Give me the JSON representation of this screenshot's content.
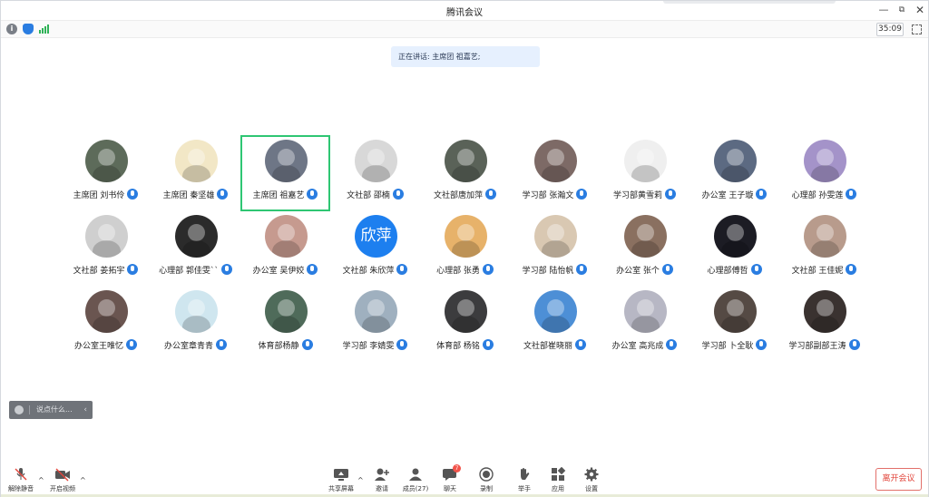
{
  "window": {
    "title": "腾讯会议"
  },
  "infobar": {
    "timer": "35:09"
  },
  "speaking": {
    "text": "正在讲话: 主席团 祖嘉艺;"
  },
  "participants": [
    {
      "name": "主席团 刘书伶",
      "avatar_color": "#5d6b5a",
      "active": false
    },
    {
      "name": "主席团 秦坚雄",
      "avatar_color": "#f2e7c6",
      "active": false
    },
    {
      "name": "主席团 祖嘉艺",
      "avatar_color": "#6e7686",
      "active": true
    },
    {
      "name": "文社部 邵楠",
      "avatar_color": "#d8d8d8",
      "active": false
    },
    {
      "name": "文社部唐加萍",
      "avatar_color": "#5a6258",
      "active": false
    },
    {
      "name": "学习部 张瀚文",
      "avatar_color": "#7d6a66",
      "active": false
    },
    {
      "name": "学习部黄雪莉",
      "avatar_color": "#efefef",
      "active": false
    },
    {
      "name": "办公室 王子璇",
      "avatar_color": "#5c6a82",
      "active": false
    },
    {
      "name": "心理部 孙雯莲",
      "avatar_color": "#a493c9",
      "active": false
    },
    {
      "name": "文社部 姜拓宇",
      "avatar_color": "#cfcfcf",
      "active": false
    },
    {
      "name": "心理部 郭佳雯``",
      "avatar_color": "#2b2b2b",
      "active": false
    },
    {
      "name": "办公室 吴伊姣",
      "avatar_color": "#c69a8f",
      "active": false
    },
    {
      "name": "文社部 朱欣萍",
      "avatar_color": "#1d7fef",
      "avatar_text": "欣萍",
      "active": false
    },
    {
      "name": "心理部 张勇",
      "avatar_color": "#e7b26a",
      "active": false
    },
    {
      "name": "学习部 陆怡帆",
      "avatar_color": "#d9c8b2",
      "active": false
    },
    {
      "name": "办公室 张个",
      "avatar_color": "#8a7060",
      "active": false
    },
    {
      "name": "心理部傅哲",
      "avatar_color": "#1c1c24",
      "active": false
    },
    {
      "name": "文社部 王佳妮",
      "avatar_color": "#b89b8c",
      "active": false
    },
    {
      "name": "办公室王唯忆",
      "avatar_color": "#6a5550",
      "active": false
    },
    {
      "name": "办公室章青青",
      "avatar_color": "#cfe6ef",
      "active": false
    },
    {
      "name": "体育部杨静",
      "avatar_color": "#4f6b5a",
      "active": false
    },
    {
      "name": "学习部 李婧雯",
      "avatar_color": "#9fb0bf",
      "active": false
    },
    {
      "name": "体育部 杨铭",
      "avatar_color": "#3c3c3e",
      "active": false
    },
    {
      "name": "文社部崔晓丽",
      "avatar_color": "#4d8fd6",
      "active": false
    },
    {
      "name": "办公室 高兆成",
      "avatar_color": "#b7b7c4",
      "active": false
    },
    {
      "name": "学习部 卜全耿",
      "avatar_color": "#554a44",
      "active": false
    },
    {
      "name": "学习部副部王涛",
      "avatar_color": "#3a3230",
      "active": false
    }
  ],
  "chat": {
    "placeholder": "说点什么..."
  },
  "toolbar": {
    "unmute": "解除静音",
    "start_video": "开启视频",
    "share": "共享屏幕",
    "invite": "邀请",
    "members": "成员(27)",
    "chat": "聊天",
    "chat_badge": "7",
    "record": "录制",
    "raise_hand": "举手",
    "apps": "应用",
    "settings": "设置",
    "leave": "离开会议"
  },
  "colors": {
    "accent": "#2a7de1",
    "active_border": "#2ec673",
    "leave": "#e2453b"
  }
}
